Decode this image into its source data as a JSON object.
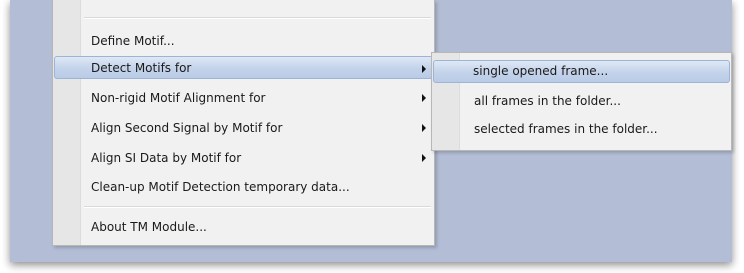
{
  "menu": {
    "items": [
      {
        "label": "Define Motif...",
        "submenu": false
      },
      {
        "label": "Detect Motifs for",
        "submenu": true
      },
      {
        "label": "Non-rigid Motif Alignment for",
        "submenu": true
      },
      {
        "label": "Align Second Signal by Motif for",
        "submenu": true
      },
      {
        "label": "Align SI Data by Motif for",
        "submenu": true
      },
      {
        "label": "Clean-up Motif Detection temporary data...",
        "submenu": false
      },
      {
        "label": "About TM Module...",
        "submenu": false
      }
    ],
    "highlighted": "Detect Motifs for"
  },
  "submenu": {
    "items": [
      {
        "label": "single opened frame..."
      },
      {
        "label": "all frames in the folder..."
      },
      {
        "label": "selected frames in the folder..."
      }
    ],
    "highlighted": "single opened frame..."
  },
  "colors": {
    "background": "#b3bdd6",
    "menu_bg": "#f1f1f1",
    "highlight": "#c3d3ea"
  }
}
